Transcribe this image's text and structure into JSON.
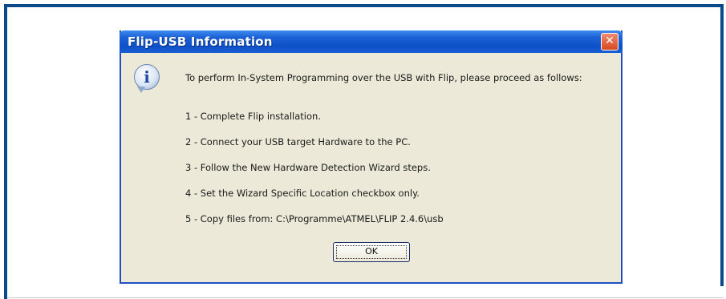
{
  "dialog": {
    "title": "Flip-USB Information",
    "close_icon": "close-icon",
    "icon": "info-icon",
    "intro": "To perform In-System Programming over the USB with Flip, please proceed as follows:",
    "steps": [
      "1 - Complete Flip installation.",
      "2 - Connect your USB target Hardware to the PC.",
      "3 - Follow the New Hardware Detection Wizard steps.",
      "4 - Set the Wizard Specific Location checkbox only.",
      "5 - Copy files from: C:\\Programme\\ATMEL\\FLIP 2.4.6\\usb"
    ],
    "ok_label": "OK"
  },
  "colors": {
    "frame": "#0a4a8a",
    "titlebar": "#0d50c8",
    "dialog_bg": "#ece9d8",
    "close_button": "#d44a20"
  }
}
